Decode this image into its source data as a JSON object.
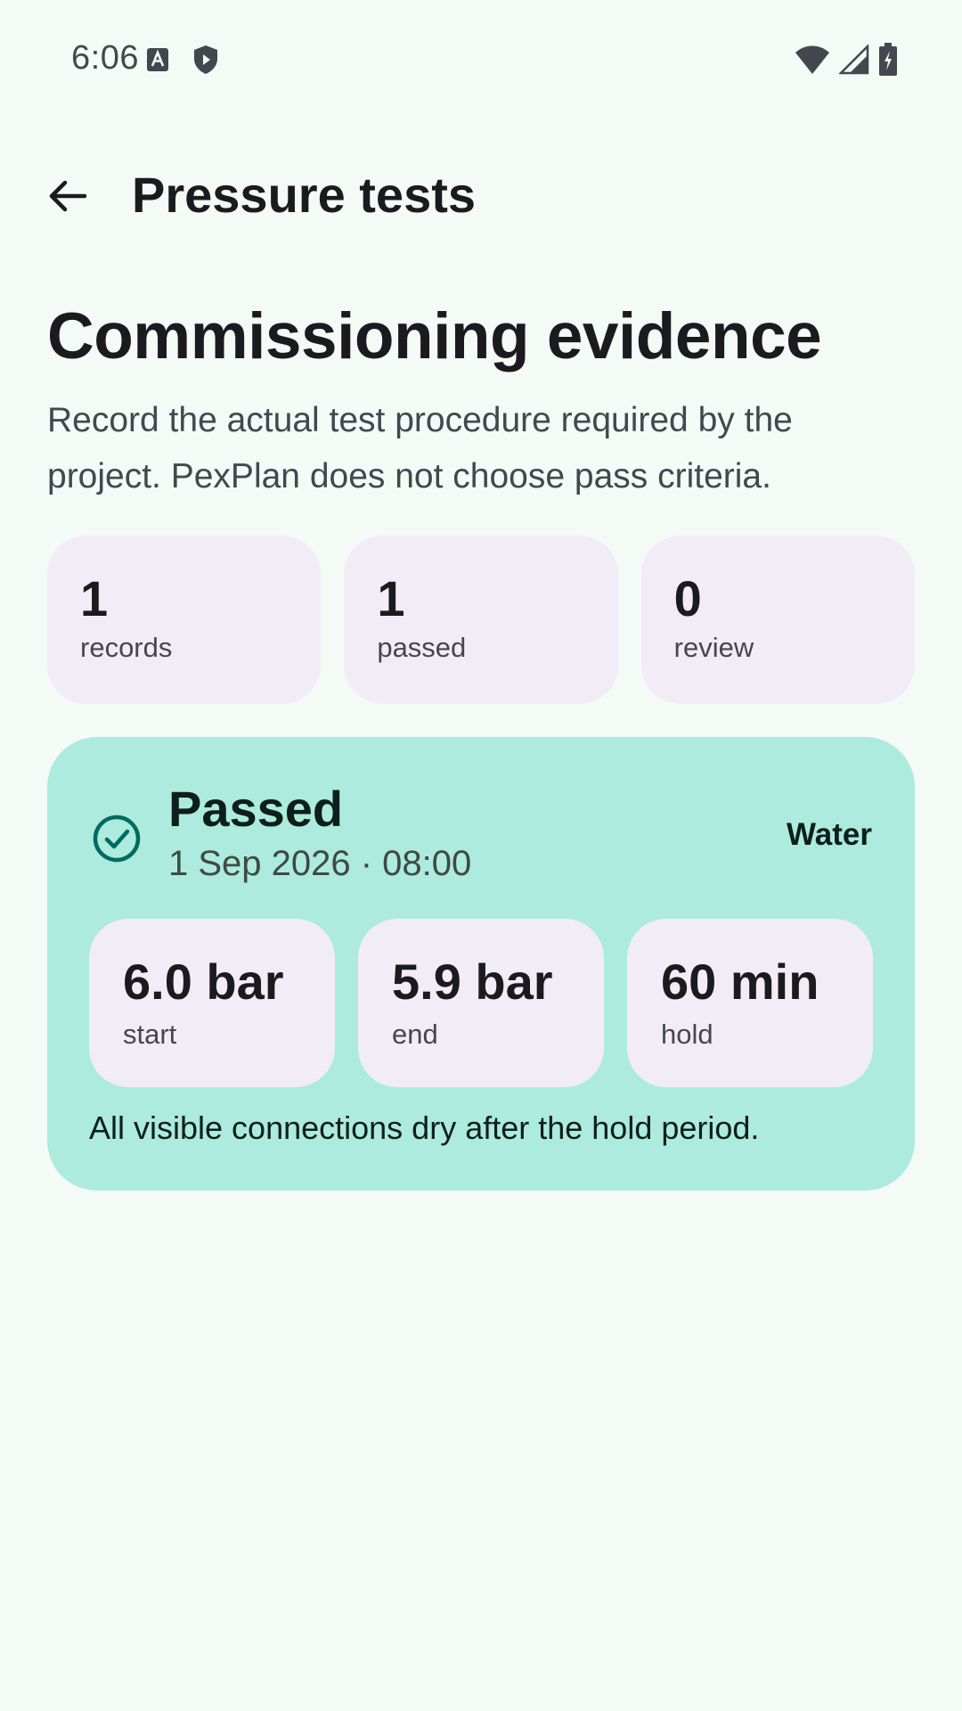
{
  "status_bar": {
    "time": "6:06",
    "left_icons": [
      "font-a-icon",
      "shield-play-icon"
    ],
    "right_icons": [
      "wifi-icon",
      "cell-signal-icon",
      "battery-charging-icon"
    ]
  },
  "app_bar": {
    "back_icon": "arrow-back-icon",
    "title": "Pressure tests"
  },
  "header": {
    "headline": "Commissioning evidence",
    "description": "Record the actual test procedure required by the project. PexPlan does not choose pass criteria."
  },
  "stats": [
    {
      "value": "1",
      "label": "records"
    },
    {
      "value": "1",
      "label": "passed"
    },
    {
      "value": "0",
      "label": "review"
    }
  ],
  "record": {
    "status_icon": "check-circle-icon",
    "status": "Passed",
    "date": "1 Sep 2026 · 08:00",
    "medium": "Water",
    "metrics": [
      {
        "value": "6.0 bar",
        "label": "start"
      },
      {
        "value": "5.9 bar",
        "label": "end"
      },
      {
        "value": "60 min",
        "label": "hold"
      }
    ],
    "note": "All visible connections dry after the hold period."
  },
  "colors": {
    "background": "#f4faf6",
    "stat_card": "#f2ecf7",
    "record_card": "#acebdd",
    "accent": "#006a60"
  }
}
